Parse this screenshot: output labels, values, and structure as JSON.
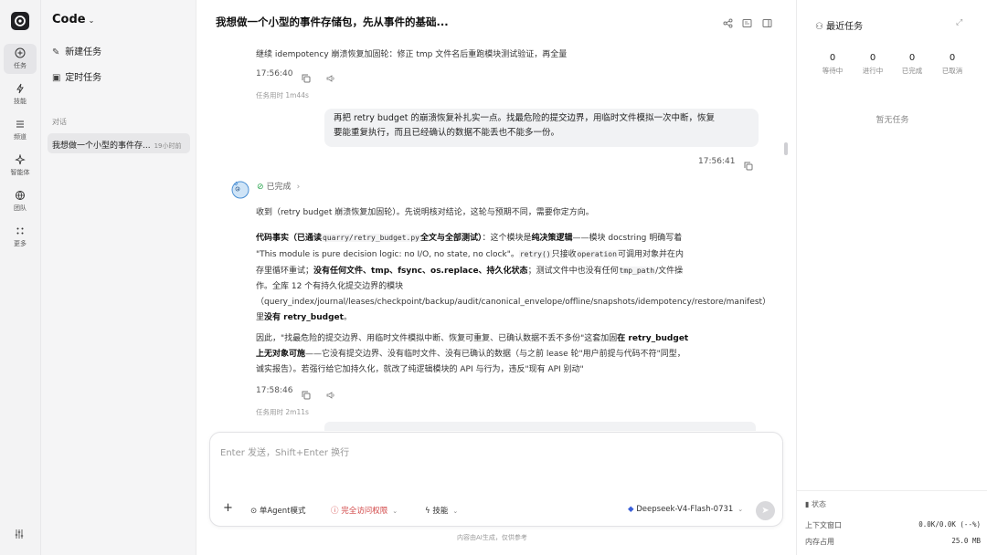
{
  "rail": {
    "items": [
      {
        "label": "任务",
        "icon": "plus-circle-icon"
      },
      {
        "label": "技能",
        "icon": "lightning-icon"
      },
      {
        "label": "频道",
        "icon": "list-icon"
      },
      {
        "label": "智能体",
        "icon": "sparkle-icon"
      },
      {
        "label": "团队",
        "icon": "globe-icon"
      },
      {
        "label": "更多",
        "icon": "dots-icon"
      }
    ]
  },
  "sidebar": {
    "title": "Code",
    "new_task": "新建任务",
    "scheduled_task": "定时任务",
    "section_label": "对话",
    "conversation": {
      "title": "我想做一个小型的事件存...",
      "time": "19小时前"
    }
  },
  "header": {
    "title": "我想做一个小型的事件存储包，先从事件的基础..."
  },
  "messages": {
    "first_text": "继续 idempotency 崩溃恢复加固轮：修正 tmp 文件名后重跑模块测试验证，再全量",
    "first_time": "17:56:40",
    "first_duration": "任务用时 1m44s",
    "user_line1": "再把 retry budget 的崩溃恢复补扎实一点。找最危险的提交边界，用临时文件模拟一次中断，恢复",
    "user_line2": "要能重复执行，而且已经确认的数据不能丢也不能多一份。",
    "user_time": "17:56:41",
    "ai_status": "已完成",
    "ai_intro": "收到（retry budget 崩溃恢复加固轮）。先说明核对结论，这轮与预期不同，需要你定方向。",
    "p1_b1": "代码事实（已通读",
    "p1_code1": "quarry/retry_budget.py",
    "p1_b2": "全文与全部测试）",
    "p1_t1": "：这个模块是",
    "p1_b3": "纯决策逻辑",
    "p1_t2": "——模块 docstring 明确写着 \"This module is pure decision logic: no I/O, no state, no clock\"。",
    "p1_code2": "retry()",
    "p1_t3": "只接收",
    "p1_code3": "operation",
    "p1_t4": "可调用对象并在内存里循环重试；",
    "p1_b4": "没有任何文件、tmp、fsync、os.replace、持久化状态",
    "p1_t5": "；测试文件中也没有任何",
    "p1_code4": "tmp_path",
    "p1_t6": "/文件操作。全库 12 个有持久化提交边界的模块（query_index/journal/leases/checkpoint/backup/audit/canonical_envelope/offline/snapshots/idempotency/restore/manifest）里",
    "p1_b5": "没有 retry_budget",
    "p1_t7": "。",
    "p2_t1": "因此，\"找最危险的提交边界、用临时文件模拟中断、恢复可重复、已确认数据不丢不多份\"这套加固",
    "p2_b1": "在 retry_budget 上无对象可施",
    "p2_t2": "——它没有提交边界、没有临时文件、没有已确认的数据（与之前 lease 轮\"用户前提与代码不符\"同型，诚实报告）。若强行给它加持久化，就改了纯逻辑模块的 API 与行为，违反\"现有 API 别动\"",
    "ai_time": "17:58:46",
    "ai_duration": "任务用时 2m11s"
  },
  "composer": {
    "placeholder": "Enter 发送，Shift+Enter 换行",
    "mode": "单Agent模式",
    "permission": "完全访问权限",
    "skills": "技能",
    "model": "Deepseek-V4-Flash-0731"
  },
  "footnote": "内容由AI生成，仅供参考",
  "right_panel": {
    "title": "最近任务",
    "stats": [
      {
        "value": "0",
        "label": "等待中"
      },
      {
        "value": "0",
        "label": "进行中"
      },
      {
        "value": "0",
        "label": "已完成"
      },
      {
        "value": "0",
        "label": "已取消"
      }
    ],
    "empty": "暂无任务",
    "status_label": "状态",
    "context_label": "上下文窗口",
    "context_value": "0.0K/0.0K (--%)",
    "memory_label": "内存占用",
    "memory_value": "25.0 MB"
  },
  "colors": {
    "accent_green": "#2aa44f",
    "permission_red": "#d14343"
  }
}
